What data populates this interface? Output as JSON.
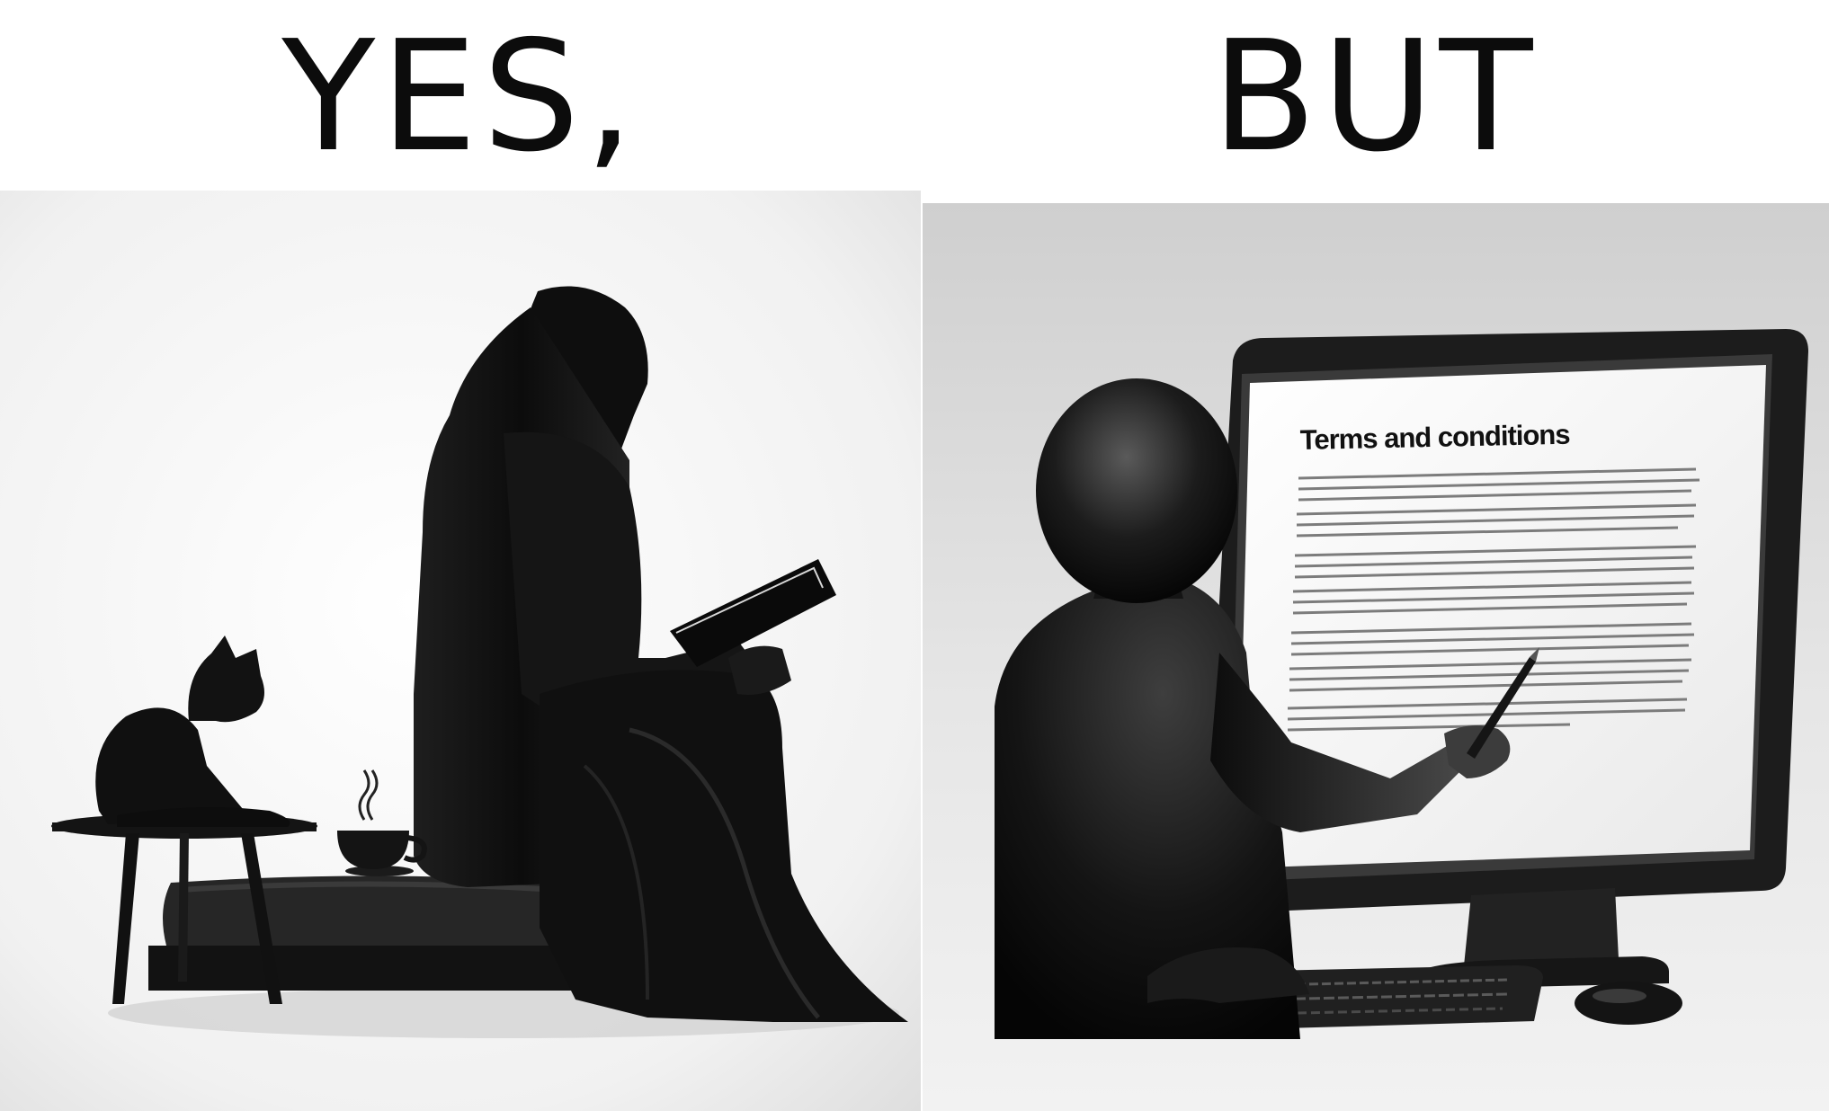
{
  "captions": {
    "left": "YES,",
    "right": "BUT"
  },
  "screen": {
    "title": "Terms and conditions"
  },
  "icons": {
    "left_panel": [
      "person-reading-silhouette",
      "book-icon",
      "cat-silhouette",
      "side-table",
      "coffee-cup-icon",
      "steam-icon",
      "cushion-seat"
    ],
    "right_panel": [
      "faceless-figure",
      "monitor",
      "keyboard",
      "mouse",
      "stylus-pen"
    ]
  }
}
